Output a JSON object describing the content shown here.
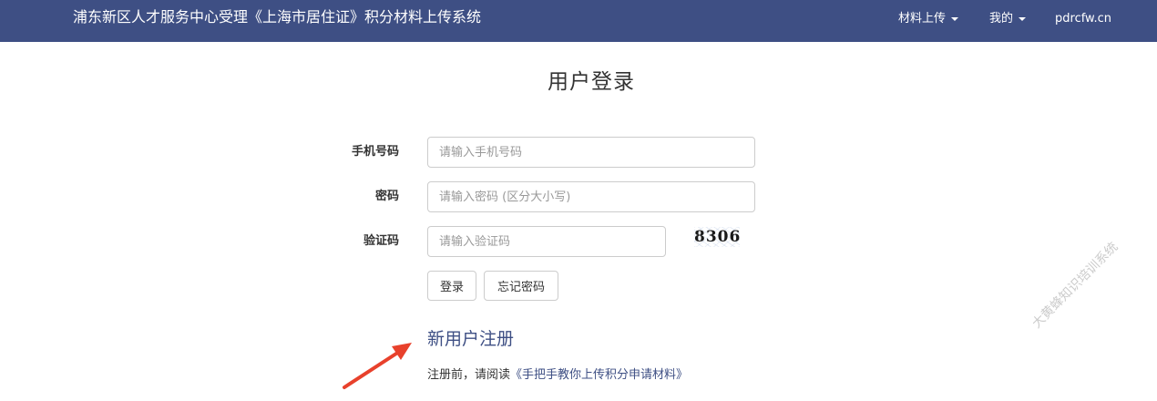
{
  "navbar": {
    "brand": "浦东新区人才服务中心受理《上海市居住证》积分材料上传系统",
    "items": [
      {
        "label": "材料上传",
        "has_dropdown": true
      },
      {
        "label": "我的",
        "has_dropdown": true
      },
      {
        "label": "pdrcfw.cn",
        "has_dropdown": false
      }
    ],
    "background_color": "#3e4f84"
  },
  "login": {
    "title": "用户登录",
    "phone": {
      "label": "手机号码",
      "placeholder": "请输入手机号码",
      "value": ""
    },
    "password": {
      "label": "密码",
      "placeholder": "请输入密码 (区分大小写)",
      "value": ""
    },
    "captcha": {
      "label": "验证码",
      "placeholder": "请输入验证码",
      "value": "",
      "image_text": "8306"
    },
    "login_button": "登录",
    "forgot_button": "忘记密码"
  },
  "register": {
    "link_text": "新用户注册",
    "notice_prefix": "注册前，请阅读",
    "guide_link": "《手把手教你上传积分申请材料》"
  },
  "annotation": {
    "arrow_icon": "red-arrow-icon",
    "arrow_color": "#e8412c"
  },
  "watermark": "大黄蜂知识培训系统"
}
